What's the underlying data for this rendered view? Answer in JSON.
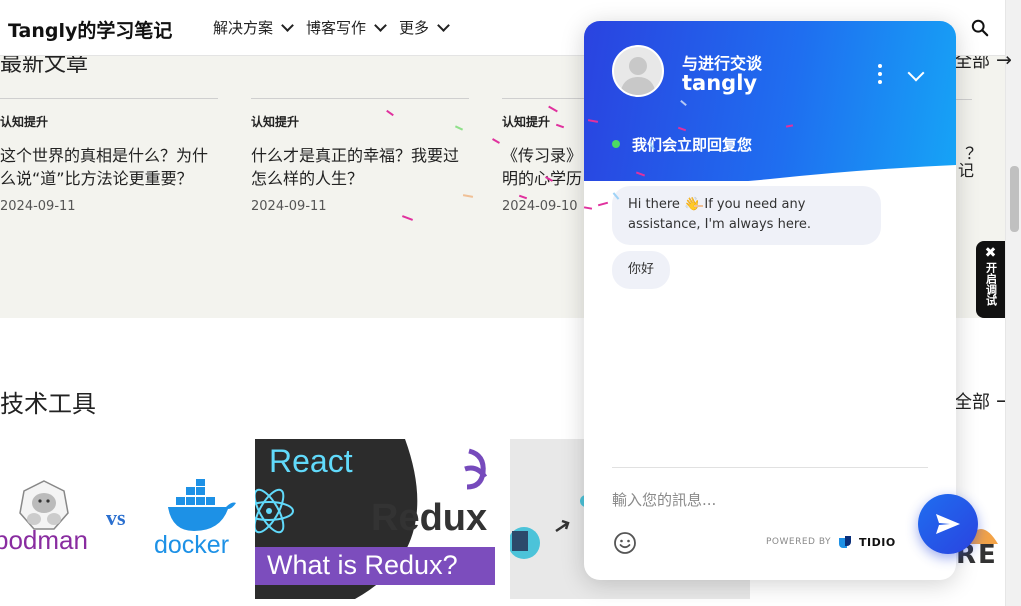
{
  "header": {
    "logo": "Tangly的学习笔记",
    "nav": [
      {
        "label": "解决方案"
      },
      {
        "label": "博客写作"
      },
      {
        "label": "更多"
      }
    ]
  },
  "latest": {
    "title": "最新文章",
    "view_all": "全部",
    "posts": [
      {
        "category": "认知提升",
        "title": "这个世界的真相是什么？为什么说“道”比方法论更重要？",
        "date": "2024-09-11"
      },
      {
        "category": "认知提升",
        "title": "什么才是真正的幸福？我要过怎么样的人生？",
        "date": "2024-09-11"
      },
      {
        "category": "认知提升",
        "title": "《传习录》明的心学历",
        "date": "2024-09-10"
      }
    ],
    "partial_right_title": "？记"
  },
  "tools": {
    "title": "技术工具",
    "view_all": "全部",
    "thumb1": {
      "left": "podman",
      "vs": "vs",
      "right": "docker"
    },
    "thumb2": {
      "top": "React",
      "mid": "Redux",
      "bottom": "What is Redux?"
    },
    "thumb4_partial": "RE"
  },
  "debug_tab": {
    "label": "开启调试"
  },
  "chat": {
    "subtitle": "与进行交谈",
    "agent_name": "tangly",
    "status": "我们会立即回复您",
    "messages": [
      {
        "text": "Hi there 👋 If you need any assistance, I'm always here."
      },
      {
        "text": "你好"
      }
    ],
    "input_placeholder": "輸入您的訊息...",
    "powered_by": "POWERED BY",
    "brand": "TIDIO"
  }
}
